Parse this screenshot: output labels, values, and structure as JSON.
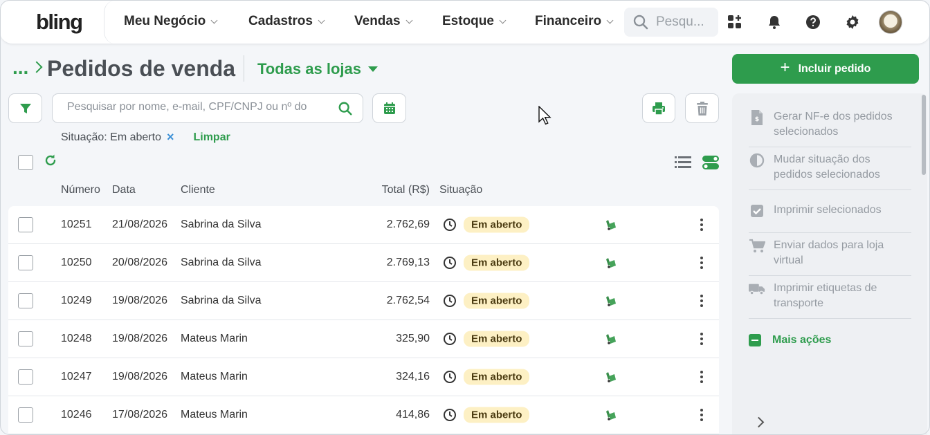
{
  "nav": {
    "logo": "bling",
    "items": [
      "Meu Negócio",
      "Cadastros",
      "Vendas",
      "Estoque",
      "Financeiro"
    ],
    "search_placeholder": "Pesquisar",
    "search_display": "Pesqu...",
    "icons": [
      "apps-icon",
      "bell-icon",
      "help-icon",
      "gear-icon",
      "avatar"
    ]
  },
  "breadcrumb": {
    "ellipsis": "..."
  },
  "page": {
    "title": "Pedidos de venda",
    "store_select": "Todas as lojas"
  },
  "toolbar": {
    "search_placeholder": "Pesquisar por nome, e-mail, CPF/CNPJ ou nº do pedido",
    "filter_text": "Situação: Em aberto",
    "filter_remove": "×",
    "clear_label": "Limpar"
  },
  "table": {
    "headers": {
      "numero": "Número",
      "data": "Data",
      "cliente": "Cliente",
      "total": "Total (R$)",
      "situacao": "Situação"
    },
    "rows": [
      {
        "numero": "10251",
        "data": "21/08/2026",
        "cliente": "Sabrina da Silva",
        "total": "2.762,69",
        "situacao": "Em aberto"
      },
      {
        "numero": "10250",
        "data": "20/08/2026",
        "cliente": "Sabrina da Silva",
        "total": "2.769,13",
        "situacao": "Em aberto"
      },
      {
        "numero": "10249",
        "data": "19/08/2026",
        "cliente": "Sabrina da Silva",
        "total": "2.762,54",
        "situacao": "Em aberto"
      },
      {
        "numero": "10248",
        "data": "19/08/2026",
        "cliente": "Mateus Marin",
        "total": "325,90",
        "situacao": "Em aberto"
      },
      {
        "numero": "10247",
        "data": "19/08/2026",
        "cliente": "Mateus Marin",
        "total": "324,16",
        "situacao": "Em aberto"
      },
      {
        "numero": "10246",
        "data": "17/08/2026",
        "cliente": "Mateus Marin",
        "total": "414,86",
        "situacao": "Em aberto"
      }
    ]
  },
  "actions": {
    "add_label": "Incluir pedido",
    "items": [
      {
        "label": "Gerar NF-e dos pedidos selecionados",
        "icon": "invoice-icon"
      },
      {
        "label": "Mudar situação dos pedidos selecionados",
        "icon": "half-circle-icon"
      },
      {
        "label": "Imprimir selecionados",
        "icon": "checkbox-icon"
      },
      {
        "label": "Enviar dados para loja virtual",
        "icon": "cart-icon"
      },
      {
        "label": "Imprimir etiquetas de transporte",
        "icon": "truck-icon"
      }
    ],
    "more_label": "Mais ações"
  },
  "colors": {
    "accent": "#2e9c4d",
    "badge_bg": "#fdf0c4",
    "link_blue": "#3a8fd6"
  }
}
